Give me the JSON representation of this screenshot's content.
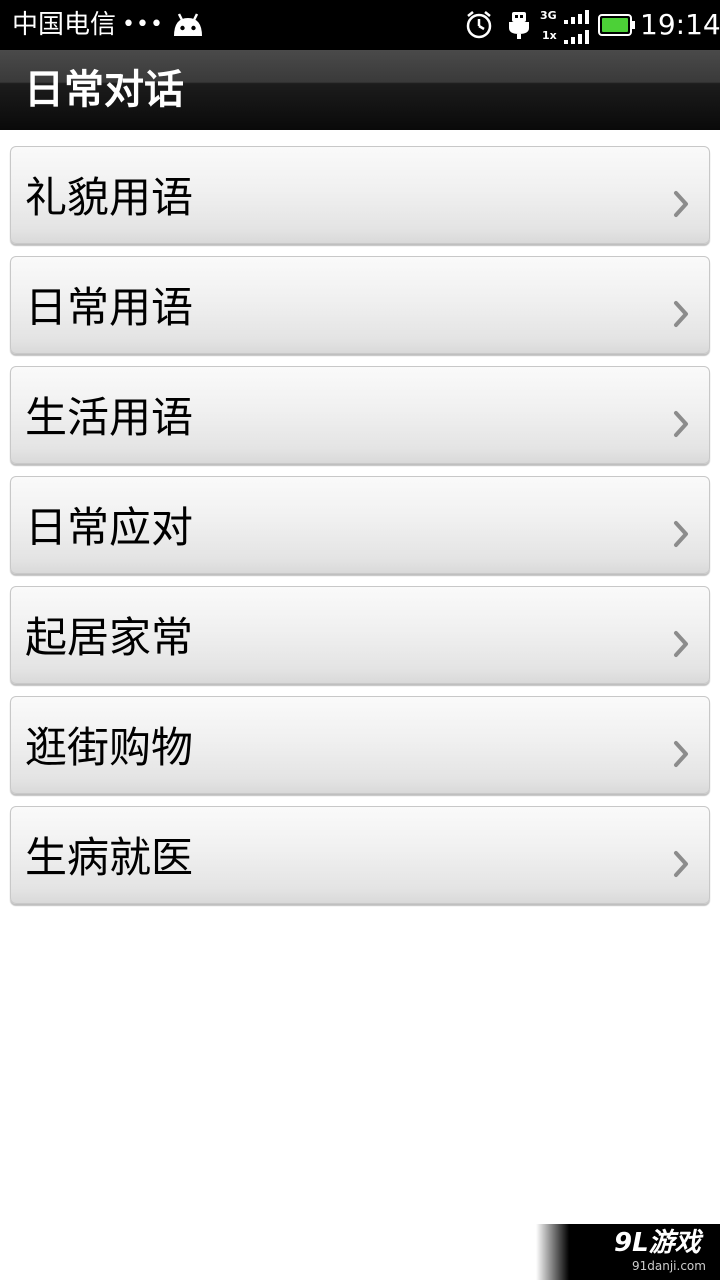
{
  "status_bar": {
    "carrier": "中国电信",
    "dots": "•••",
    "network_top": "3G",
    "network_bottom": "1x",
    "time": "19:14",
    "icons": [
      "android-icon",
      "alarm-icon",
      "usb-icon",
      "signal-icon",
      "battery-icon"
    ],
    "battery_color": "#4cd137"
  },
  "header": {
    "title": "日常对话"
  },
  "list": {
    "items": [
      {
        "label": "礼貌用语"
      },
      {
        "label": "日常用语"
      },
      {
        "label": "生活用语"
      },
      {
        "label": "日常应对"
      },
      {
        "label": "起居家常"
      },
      {
        "label": "逛街购物"
      },
      {
        "label": "生病就医"
      }
    ]
  },
  "watermark": {
    "logo": "9L游戏",
    "url": "91danji.com"
  }
}
